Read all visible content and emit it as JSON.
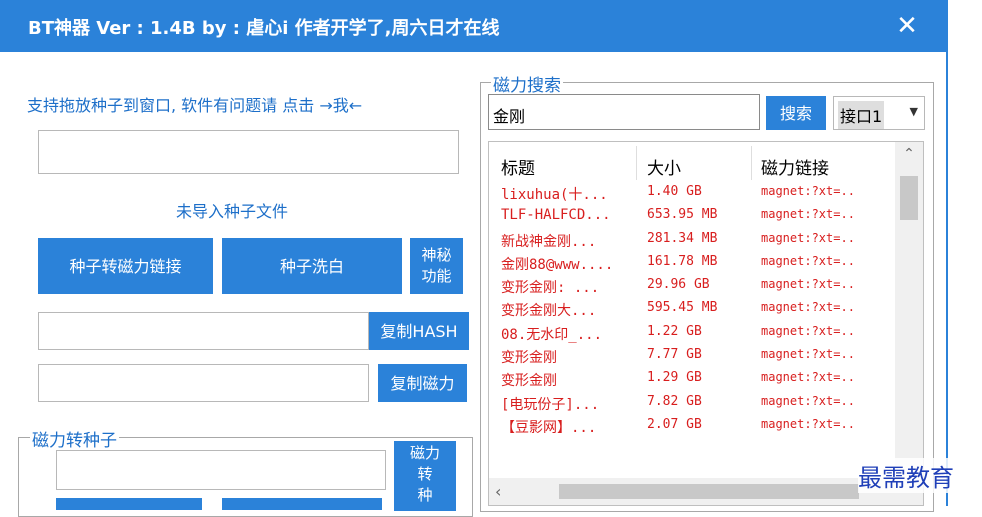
{
  "titlebar": {
    "title": "BT神器   Ver : 1.4B    by : 虐心i   作者开学了,周六日才在线",
    "close_label": "✕"
  },
  "left": {
    "hint": "支持拖放种子到窗口, 软件有问题请 点击 →我←",
    "drop_value": "",
    "status": "未导入种子文件",
    "buttons": {
      "torrent_to_magnet": "种子转磁力链接",
      "torrent_wash": "种子洗白",
      "secret": "神秘\n功能",
      "copy_hash": "复制HASH",
      "copy_magnet": "复制磁力"
    },
    "hash_value": "",
    "magnet_value": "",
    "group2": {
      "legend": "磁力转种子",
      "input_value": "",
      "convert_label": "磁力\n转\n种"
    }
  },
  "right": {
    "legend": "磁力搜索",
    "search": {
      "value": "金刚",
      "button": "搜索"
    },
    "interface": {
      "selected": "接口1"
    },
    "columns": [
      "标题",
      "大小",
      "磁力链接"
    ],
    "rows": [
      {
        "title": "lixuhua(十...",
        "size": "1.40 GB",
        "link": "magnet:?xt=.."
      },
      {
        "title": "TLF-HALFCD...",
        "size": "653.95 MB",
        "link": "magnet:?xt=.."
      },
      {
        "title": "新战神金刚...",
        "size": "281.34 MB",
        "link": "magnet:?xt=.."
      },
      {
        "title": "金刚88@www....",
        "size": "161.78 MB",
        "link": "magnet:?xt=.."
      },
      {
        "title": "变形金刚: ...",
        "size": "29.96 GB",
        "link": "magnet:?xt=.."
      },
      {
        "title": "变形金刚大...",
        "size": "595.45 MB",
        "link": "magnet:?xt=.."
      },
      {
        "title": "08.无水印_...",
        "size": "1.22 GB",
        "link": "magnet:?xt=.."
      },
      {
        "title": "变形金刚",
        "size": "7.77 GB",
        "link": "magnet:?xt=.."
      },
      {
        "title": "变形金刚",
        "size": "1.29 GB",
        "link": "magnet:?xt=.."
      },
      {
        "title": "[电玩份子]...",
        "size": "7.82 GB",
        "link": "magnet:?xt=.."
      },
      {
        "title": "【豆影网】...",
        "size": "2.07 GB",
        "link": "magnet:?xt=.."
      }
    ]
  },
  "watermark": "最需教育",
  "colors": {
    "accent": "#2b82d9",
    "link_text": "#1d6fc9",
    "result_text": "#d81e1e"
  }
}
